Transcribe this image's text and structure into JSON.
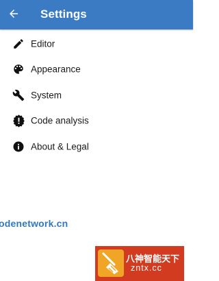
{
  "appbar": {
    "title": "Settings",
    "back_icon": "arrow-back-icon",
    "color": "#3a7bc3"
  },
  "menu": {
    "items": [
      {
        "label": "Editor",
        "icon": "pencil-icon"
      },
      {
        "label": "Appearance",
        "icon": "palette-icon"
      },
      {
        "label": "System",
        "icon": "wrench-icon"
      },
      {
        "label": "Code analysis",
        "icon": "alert-badge-icon"
      },
      {
        "label": "About & Legal",
        "icon": "info-icon"
      }
    ]
  },
  "watermarks": {
    "left_text": "odenetwork.cn",
    "right_line1": "八神智能天下",
    "right_line2": "zntx.cc"
  }
}
